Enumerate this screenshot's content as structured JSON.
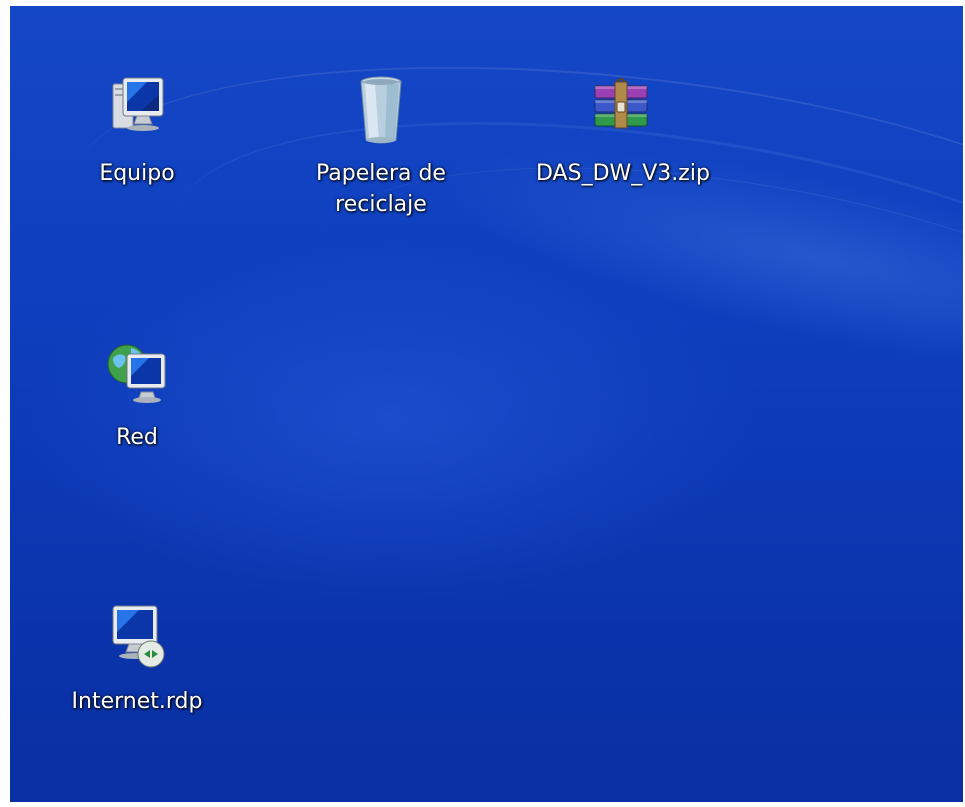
{
  "desktop": {
    "icons": [
      {
        "id": "equipo",
        "label": "Equipo",
        "icon": "computer-icon"
      },
      {
        "id": "papelera",
        "label": "Papelera de\nreciclaje",
        "icon": "recycle-bin-icon"
      },
      {
        "id": "das",
        "label": "DAS_DW_V3.zip",
        "icon": "winrar-archive-icon"
      },
      {
        "id": "red",
        "label": "Red",
        "icon": "network-icon"
      },
      {
        "id": "internet",
        "label": "Internet.rdp",
        "icon": "remote-desktop-icon"
      }
    ]
  },
  "colors": {
    "desktop_blue": "#0f3fbf",
    "label_text": "#ffffff"
  }
}
